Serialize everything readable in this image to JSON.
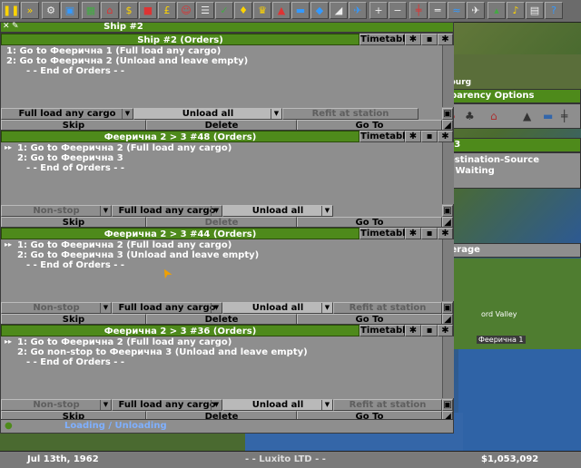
{
  "toolbar": {
    "icons": [
      "pause-icon",
      "fast-forward-icon",
      "settings-icon",
      "save-icon",
      "map-icon",
      "town-directory-icon",
      "subsidies-icon",
      "station-list-icon",
      "finances-icon",
      "company-icon",
      "story-book-icon",
      "goals-icon",
      "graphs-icon",
      "league-table-icon",
      "industry-icon",
      "train-list-icon",
      "road-vehicle-list-icon",
      "ship-list-icon",
      "aircraft-list-icon",
      "zoom-in-icon",
      "zoom-out-icon",
      "build-railway-icon",
      "build-road-icon",
      "build-tram-icon",
      "build-water-icon",
      "build-airport-icon",
      "landscaping-icon",
      "music-icon",
      "newspaper-icon",
      "help-icon"
    ]
  },
  "window_ship2_small": {
    "title": "Ship #2"
  },
  "windows": [
    {
      "title": "Ship #2 (Orders)",
      "timetable": "Timetable",
      "orders": [
        "1: Go to Феерична 1 (Full load any cargo)",
        "2: Go to Феерична 2 (Unload and leave empty)",
        "- - End of Orders - -"
      ],
      "controls": {
        "a": "Full load any cargo",
        "b": "Unload all",
        "c": "Refit at station"
      },
      "buttons": {
        "skip": "Skip",
        "delete": "Delete",
        "goto": "Go To"
      }
    },
    {
      "title": "Феерична 2 > 3 #48 (Orders)",
      "timetable": "Timetable",
      "orders": [
        "1: Go to Феерична 2 (Full load any cargo)",
        "2: Go to Феерична 3",
        "- - End of Orders - -"
      ],
      "controls": {
        "a": "Non-stop",
        "b": "Full load any cargo",
        "c": "Unload all"
      },
      "buttons": {
        "skip": "Skip",
        "delete": "Delete",
        "goto": "Go To"
      }
    },
    {
      "title": "Феерична 2 > 3 #44 (Orders)",
      "timetable": "Timetable",
      "orders": [
        "1: Go to Феерична 2 (Full load any cargo)",
        "2: Go to Феерична 3 (Unload and leave empty)",
        "- - End of Orders - -"
      ],
      "controls": {
        "a": "Non-stop",
        "b": "Full load any cargo",
        "c": "Unload all",
        "d": "Refit at station"
      },
      "buttons": {
        "skip": "Skip",
        "delete": "Delete",
        "goto": "Go To"
      }
    },
    {
      "title": "Феерична 2 > 3 #36 (Orders)",
      "timetable": "Timetable",
      "orders": [
        "1: Go to Феерична 2 (Full load any cargo)",
        "2: Go non-stop to Феерична 3 (Unload and leave empty)",
        "- - End of Orders - -"
      ],
      "controls": {
        "a": "Non-stop",
        "b": "Full load any cargo",
        "c": "Unload all",
        "d": "Refit at station"
      },
      "buttons": {
        "skip": "Skip",
        "delete": "Delete",
        "goto": "Go To"
      }
    }
  ],
  "bottom_vehicle": {
    "status": "Loading / Unloading"
  },
  "right_panels": {
    "burg_label": "sburg",
    "transparency_title": "sparency Options",
    "station_title": "a 3",
    "station_info_line1": "estination-Source",
    "station_info_line2": ": Waiting",
    "average_label": "verage",
    "town_label1": "ord Valley",
    "town_label2": "Феерична 1"
  },
  "status_bar": {
    "date": "Jul 13th, 1962",
    "company": "- - Luxito LTD - -",
    "money": "$1,053,092"
  }
}
